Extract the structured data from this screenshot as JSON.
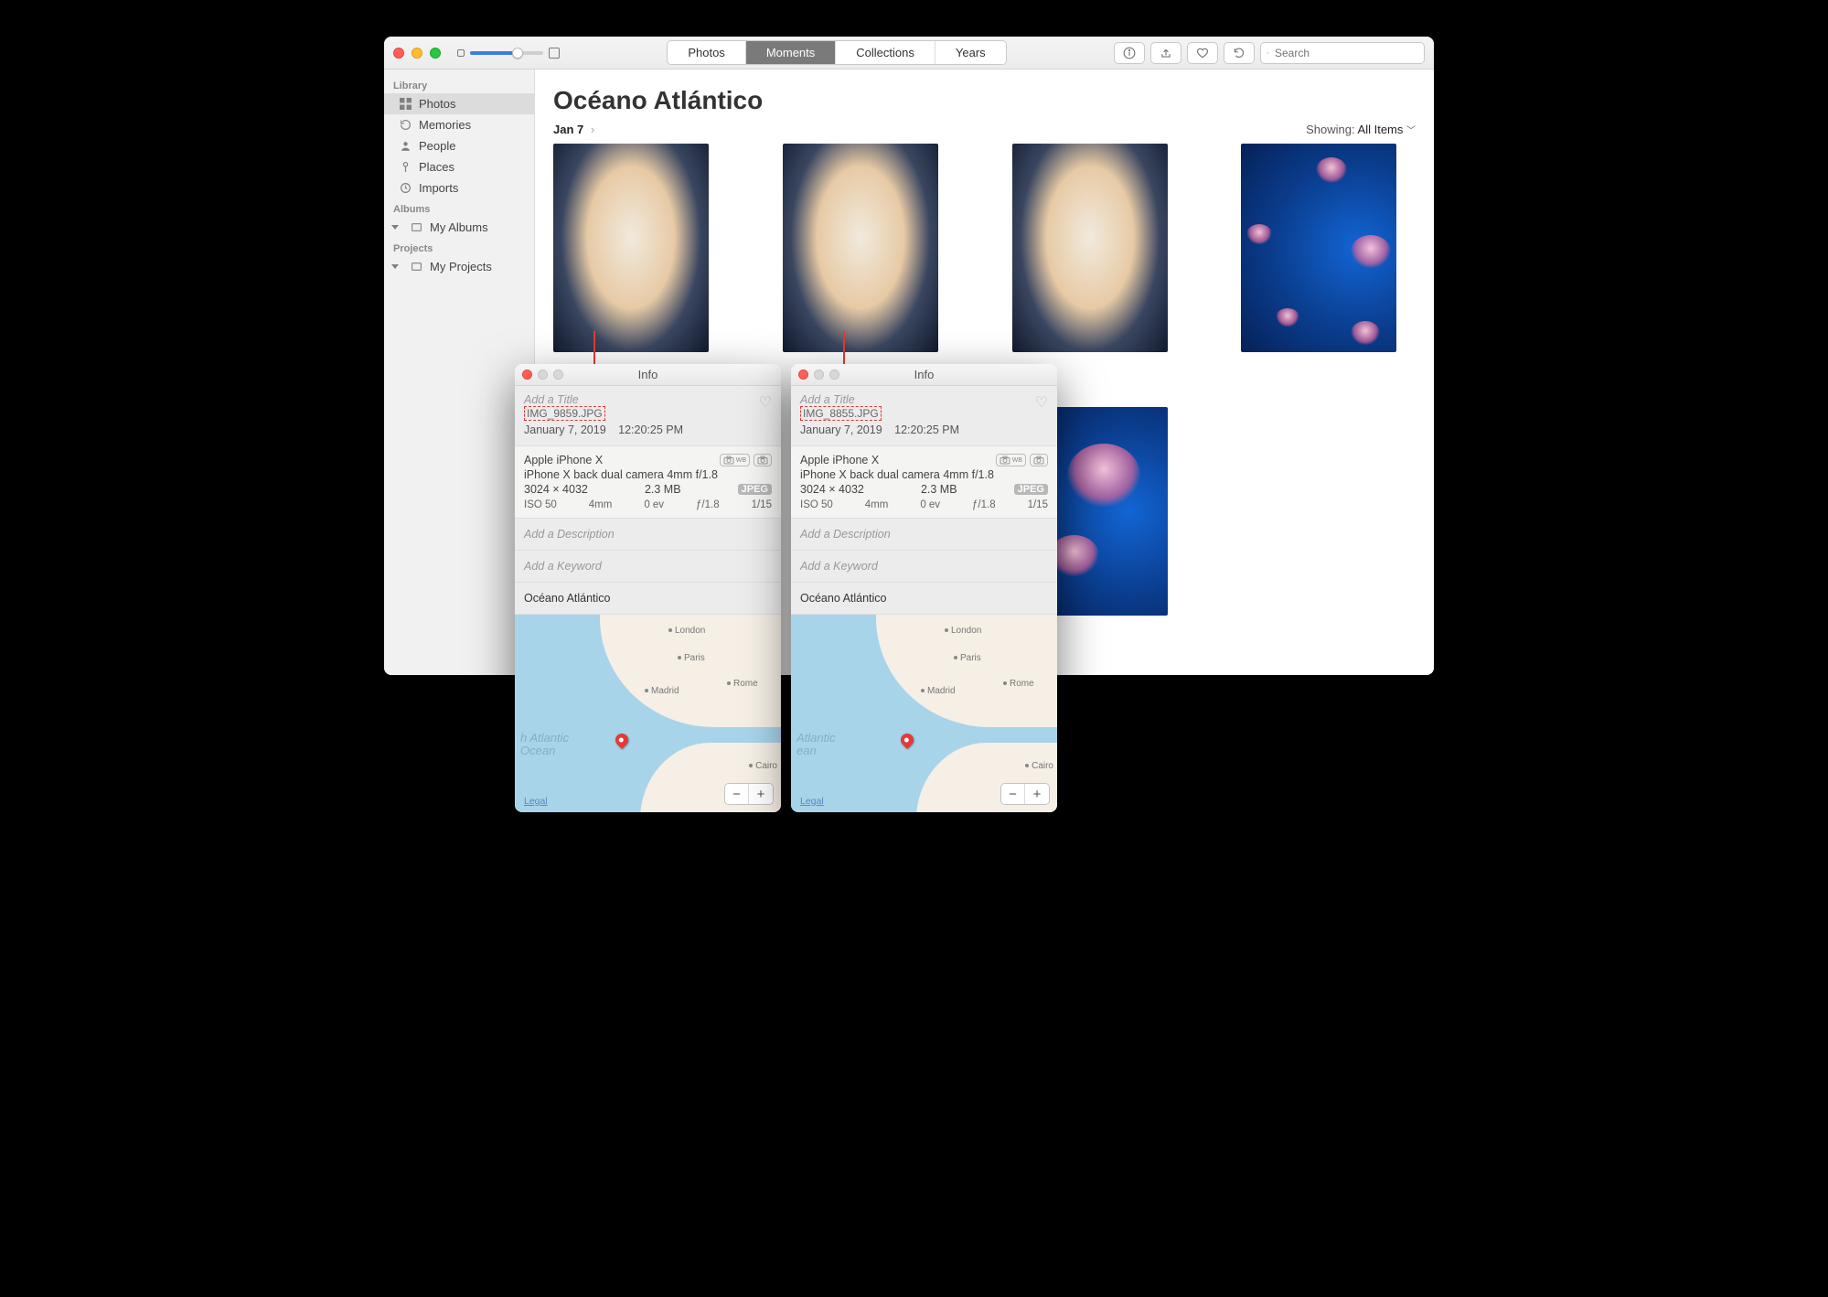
{
  "toolbar": {
    "tabs": [
      "Photos",
      "Moments",
      "Collections",
      "Years"
    ],
    "active_tab": "Moments",
    "search_placeholder": "Search"
  },
  "sidebar": {
    "sections": [
      {
        "header": "Library",
        "items": [
          {
            "label": "Photos",
            "icon": "tiles-icon",
            "active": true
          },
          {
            "label": "Memories",
            "icon": "clock-arrow-icon"
          },
          {
            "label": "People",
            "icon": "person-icon"
          },
          {
            "label": "Places",
            "icon": "pin-icon"
          },
          {
            "label": "Imports",
            "icon": "clock-icon"
          }
        ]
      },
      {
        "header": "Albums",
        "items": [
          {
            "label": "My Albums",
            "icon": "album-icon",
            "disclosure": true
          }
        ]
      },
      {
        "header": "Projects",
        "items": [
          {
            "label": "My Projects",
            "icon": "album-icon",
            "disclosure": true
          }
        ]
      }
    ]
  },
  "main": {
    "title": "Océano Atlántico",
    "date": "Jan 7",
    "showing_label": "Showing:",
    "showing_value": "All Items"
  },
  "info_title": "Info",
  "panels": [
    {
      "title_placeholder": "Add a Title",
      "filename": "IMG_9859.JPG",
      "date": "January 7, 2019",
      "time": "12:20:25 PM",
      "device": "Apple iPhone X",
      "camera": "iPhone X back dual camera 4mm f/1.8",
      "dimensions": "3024 × 4032",
      "size": "2.3 MB",
      "filetype": "JPEG",
      "exif": {
        "iso": "ISO 50",
        "focal": "4mm",
        "ev": "0 ev",
        "aperture": "ƒ/1.8",
        "shutter": "1/15"
      },
      "desc_placeholder": "Add a Description",
      "keyword_placeholder": "Add a Keyword",
      "location": "Océano Atlántico",
      "map": {
        "cities": [
          "London",
          "Paris",
          "Madrid",
          "Rome",
          "Cairo"
        ],
        "ocean_label": "h Atlantic\nOcean",
        "legal": "Legal"
      }
    },
    {
      "title_placeholder": "Add a Title",
      "filename": "IMG_8855.JPG",
      "date": "January 7, 2019",
      "time": "12:20:25 PM",
      "device": "Apple iPhone X",
      "camera": "iPhone X back dual camera 4mm f/1.8",
      "dimensions": "3024 × 4032",
      "size": "2.3 MB",
      "filetype": "JPEG",
      "exif": {
        "iso": "ISO 50",
        "focal": "4mm",
        "ev": "0 ev",
        "aperture": "ƒ/1.8",
        "shutter": "1/15"
      },
      "desc_placeholder": "Add a Description",
      "keyword_placeholder": "Add a Keyword",
      "location": "Océano Atlántico",
      "map": {
        "cities": [
          "London",
          "Paris",
          "Madrid",
          "Rome",
          "Cairo"
        ],
        "ocean_label": "Atlantic\nean",
        "legal": "Legal"
      }
    }
  ]
}
